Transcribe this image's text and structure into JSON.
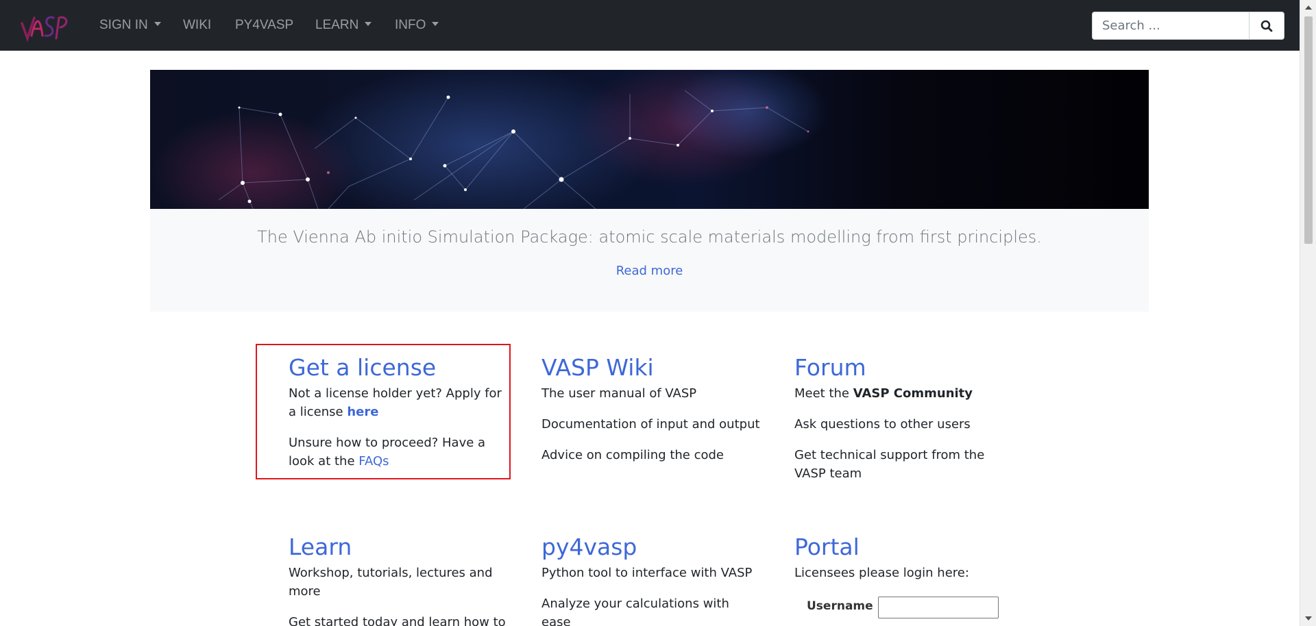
{
  "nav": {
    "items": [
      {
        "label": "SIGN IN",
        "dropdown": true
      },
      {
        "label": "WIKI",
        "dropdown": false
      },
      {
        "label": "PY4VASP",
        "dropdown": false
      },
      {
        "label": "LEARN",
        "dropdown": true
      },
      {
        "label": "INFO",
        "dropdown": true
      }
    ],
    "search_placeholder": "Search ...",
    "search_icon": "search-icon",
    "logo_icon": "vasp-logo"
  },
  "hero": {
    "lead": "The Vienna Ab initio Simulation Package: atomic scale materials modelling from first principles.",
    "read_more": "Read more"
  },
  "cards": {
    "license": {
      "title": "Get a license",
      "p1_text": "Not a license holder yet? Apply for a license ",
      "p1_link": "here",
      "p2_text": "Unsure how to proceed? Have a look at the ",
      "p2_link": "FAQs"
    },
    "wiki": {
      "title": "VASP Wiki",
      "lines": [
        "The user manual of VASP",
        "Documentation of input and output",
        "Advice on compiling the code"
      ]
    },
    "forum": {
      "title": "Forum",
      "p1_text": "Meet the ",
      "p1_bold": "VASP Community",
      "lines": [
        "Ask questions to other users",
        "Get technical support from the VASP team"
      ]
    },
    "learn": {
      "title": "Learn",
      "lines": [
        "Workshop, tutorials, lectures and more",
        "Get started today and learn how to"
      ]
    },
    "py4vasp": {
      "title": "py4vasp",
      "lines": [
        "Python tool to interface with VASP",
        "Analyze your calculations with ease"
      ]
    },
    "portal": {
      "title": "Portal",
      "intro": "Licensees please login here:",
      "username_label": "Username"
    }
  },
  "colors": {
    "navbar": "#212529",
    "link": "#3d68d7",
    "highlight": "#e0141b",
    "jumbotron": "#f8f9fa"
  }
}
